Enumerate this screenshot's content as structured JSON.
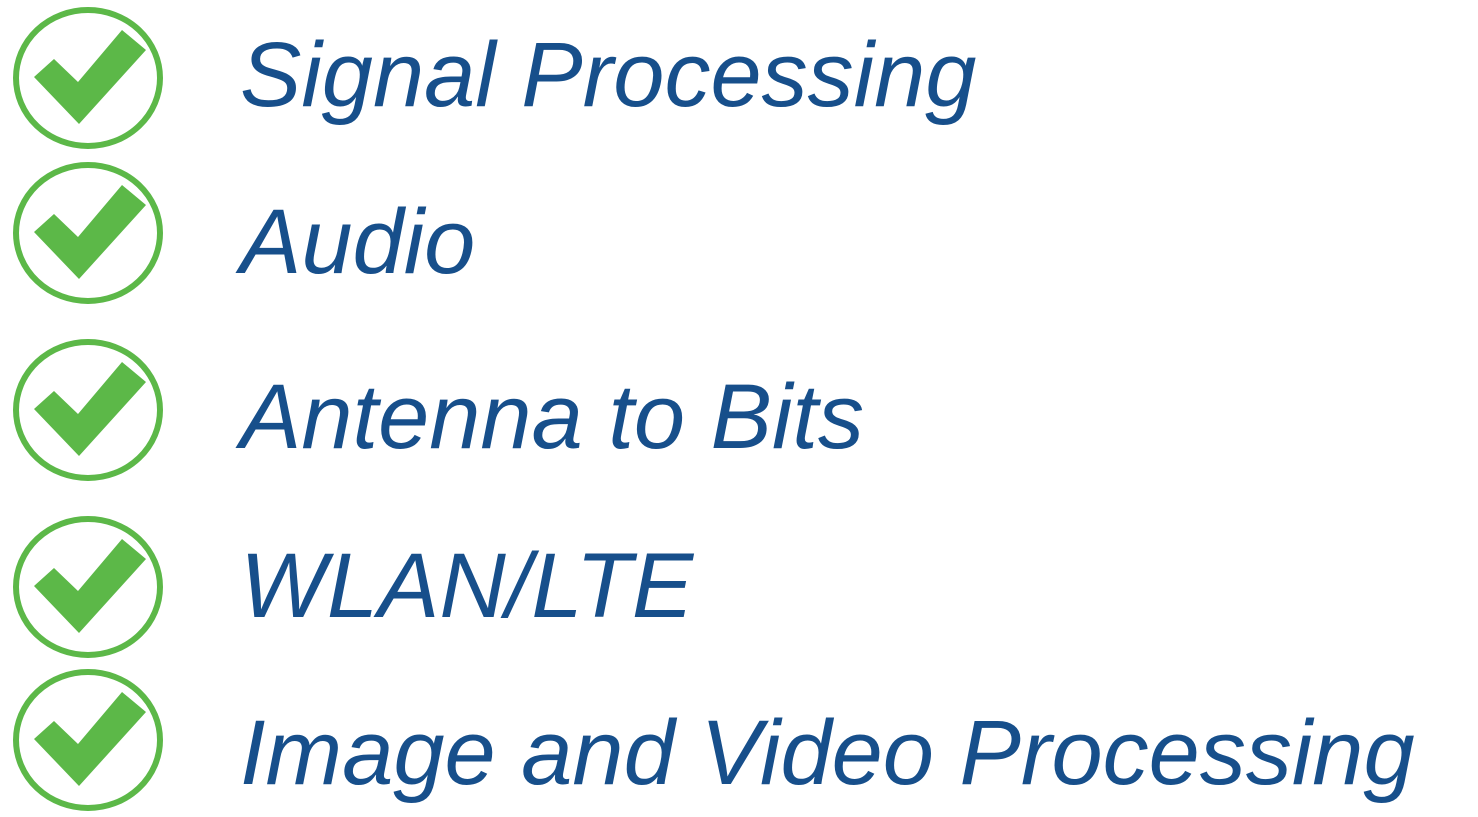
{
  "theme": {
    "text_color": "#174f8b",
    "check_fill": "#5cb848",
    "check_ring": "#5cb848"
  },
  "checklist": {
    "items": [
      {
        "label": "Signal Processing",
        "icon": "checkmark-circle-icon",
        "checked": true
      },
      {
        "label": "Audio",
        "icon": "checkmark-circle-icon",
        "checked": true
      },
      {
        "label": "Antenna to Bits",
        "icon": "checkmark-circle-icon",
        "checked": true
      },
      {
        "label": "WLAN/LTE",
        "icon": "checkmark-circle-icon",
        "checked": true
      },
      {
        "label": "Image and Video Processing",
        "icon": "checkmark-circle-icon",
        "checked": true
      }
    ]
  }
}
